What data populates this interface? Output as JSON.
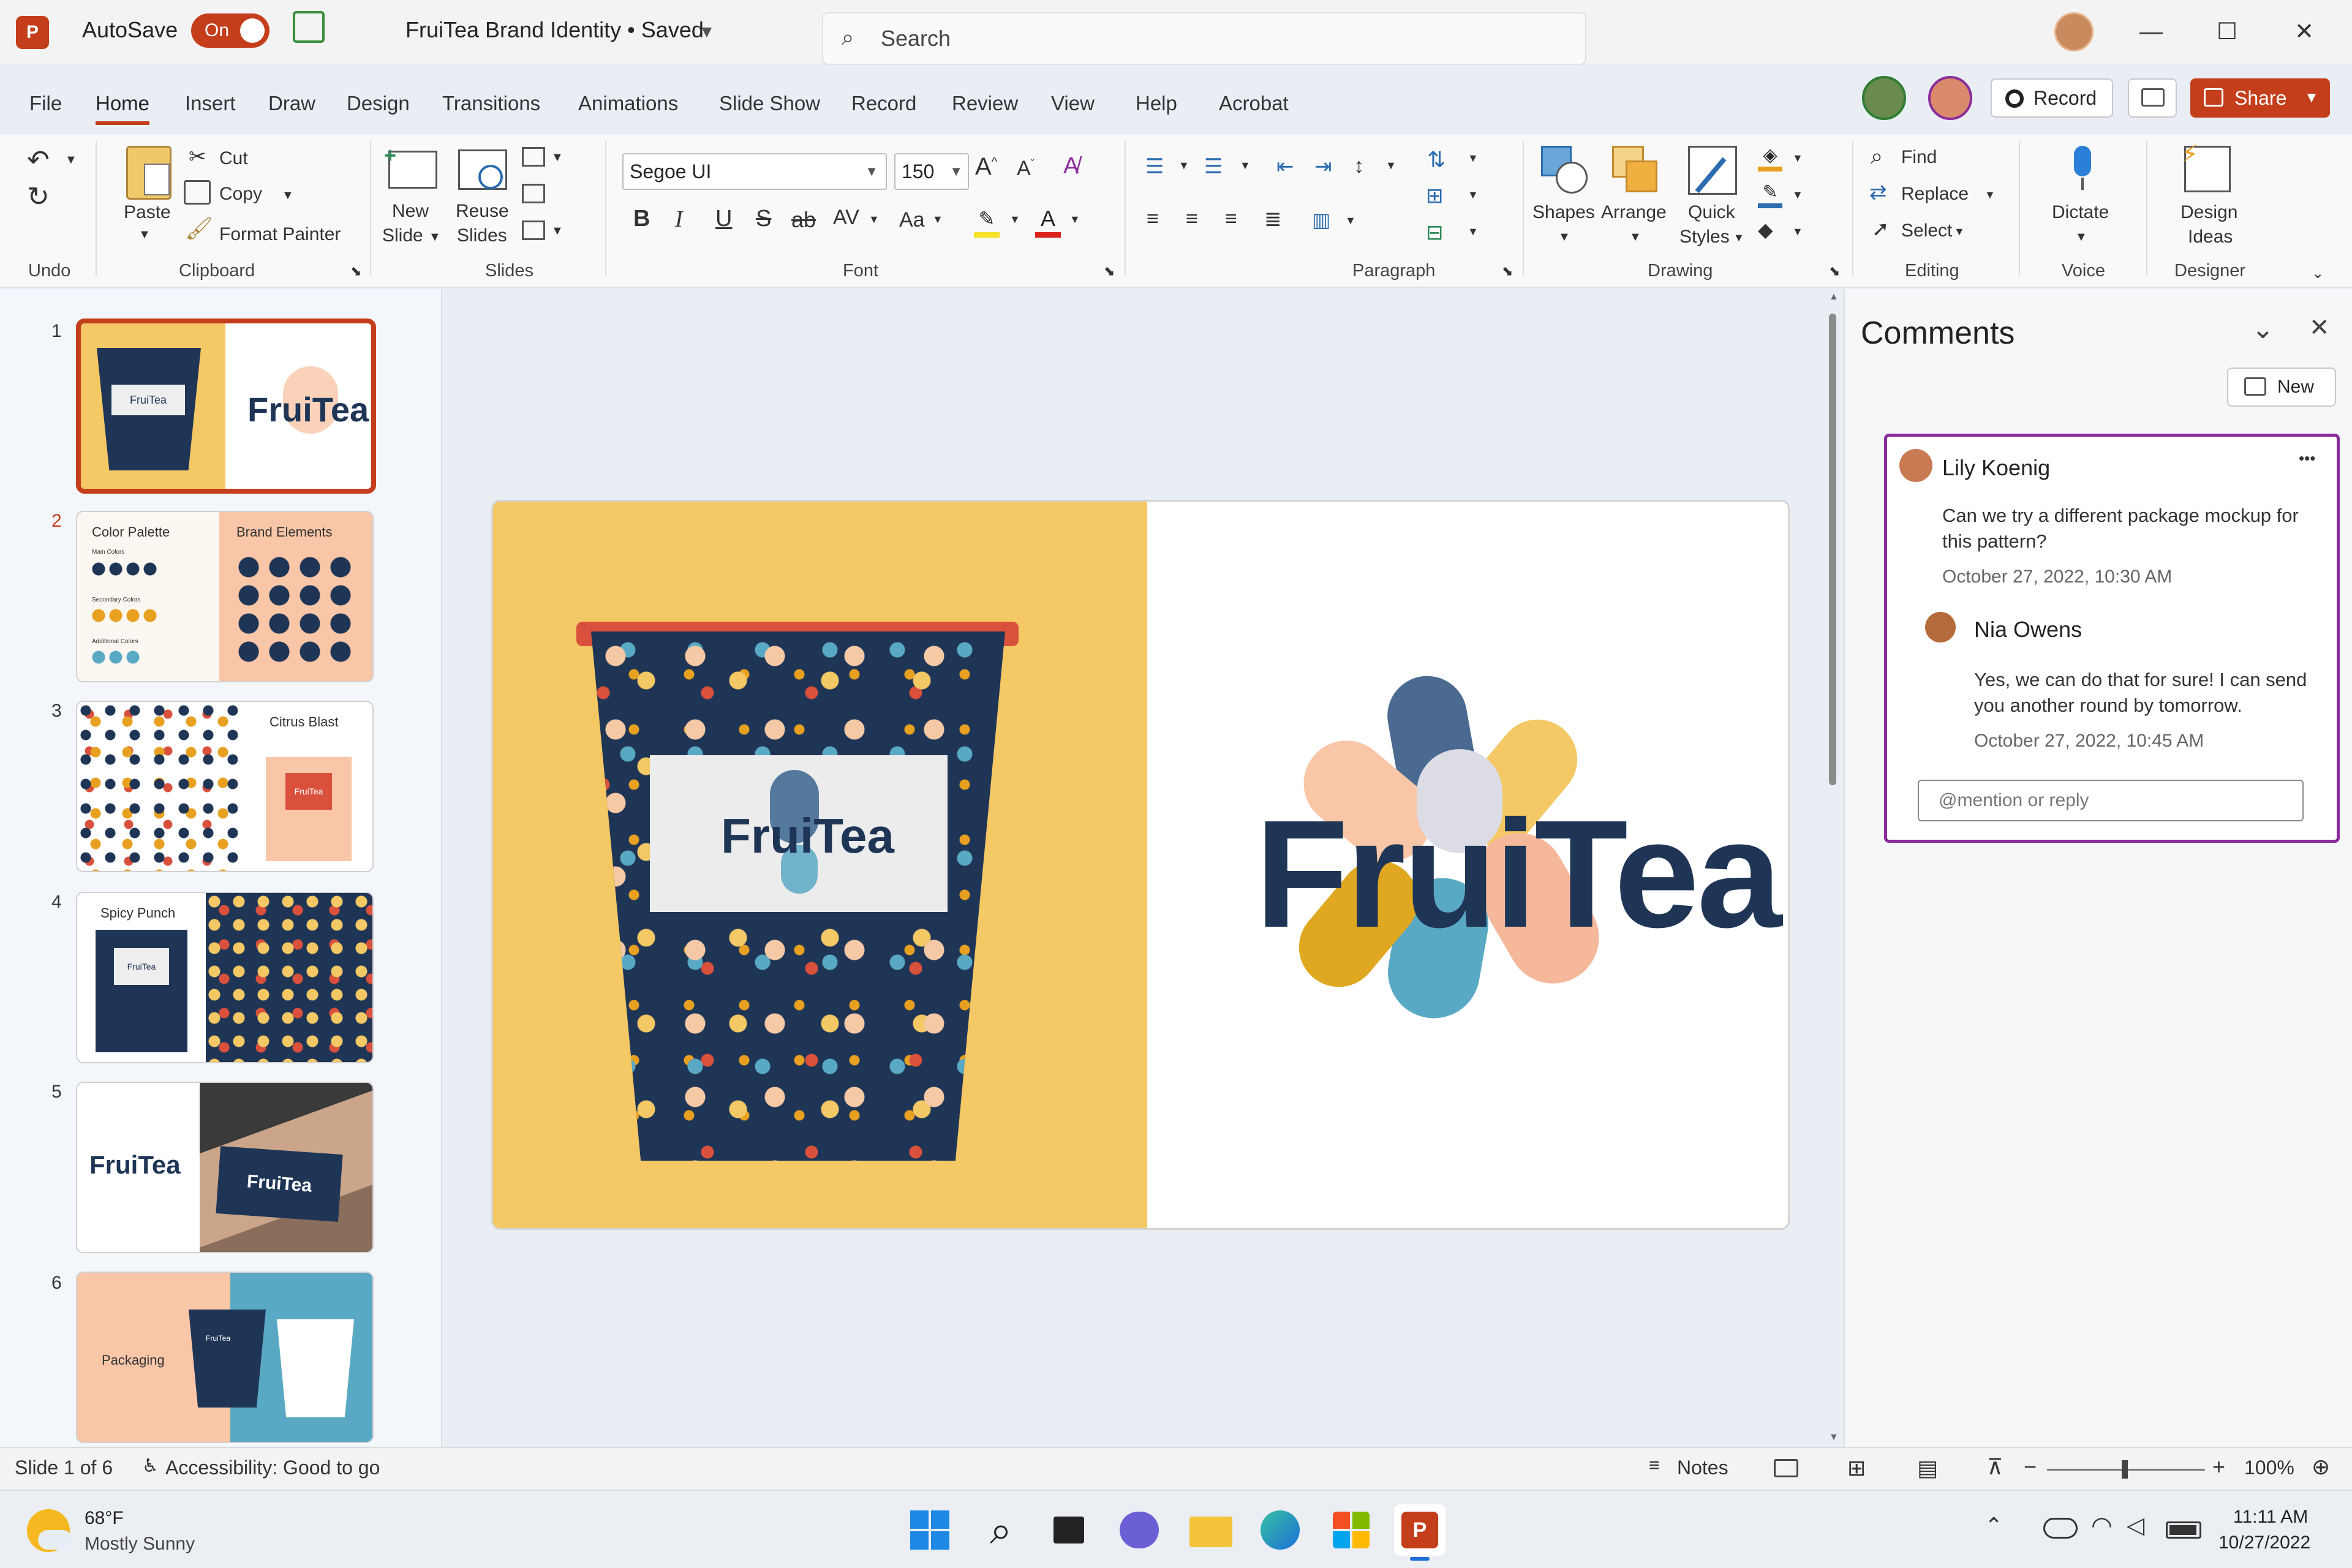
{
  "titlebar": {
    "app_badge": "P",
    "autosave_label": "AutoSave",
    "autosave_state": "On",
    "doc_title": "FruiTea Brand Identity • Saved",
    "search_placeholder": "Search"
  },
  "menu": [
    "File",
    "Home",
    "Insert",
    "Draw",
    "Design",
    "Transitions",
    "Animations",
    "Slide Show",
    "Record",
    "Review",
    "View",
    "Help",
    "Acrobat"
  ],
  "header_buttons": {
    "record": "Record",
    "share": "Share"
  },
  "ribbon": {
    "undo_label": "Undo",
    "clipboard": {
      "paste": "Paste",
      "cut": "Cut",
      "copy": "Copy",
      "format_painter": "Format Painter",
      "label": "Clipboard"
    },
    "slides": {
      "new_slide_1": "New",
      "new_slide_2": "Slide",
      "reuse_1": "Reuse",
      "reuse_2": "Slides",
      "label": "Slides"
    },
    "font": {
      "family": "Segoe UI",
      "size": "150",
      "label": "Font",
      "bold": "B",
      "italic": "I",
      "underline": "U",
      "strike": "S",
      "abc": "ab",
      "spacing": "AV",
      "case": "Aa",
      "grow": "A",
      "shrink": "A"
    },
    "paragraph_label": "Paragraph",
    "drawing": {
      "shapes": "Shapes",
      "arrange": "Arrange",
      "quick_1": "Quick",
      "quick_2": "Styles",
      "label": "Drawing"
    },
    "editing": {
      "find": "Find",
      "replace": "Replace",
      "select": "Select",
      "label": "Editing"
    },
    "voice": {
      "dictate": "Dictate",
      "label": "Voice"
    },
    "designer": {
      "ideas_1": "Design",
      "ideas_2": "Ideas",
      "label": "Designer"
    }
  },
  "thumbnails": [
    {
      "num": "1",
      "logo": "FruiTea"
    },
    {
      "num": "2",
      "left": "Color Palette",
      "right": "Brand Elements",
      "sub1": "Main Colors",
      "sub2": "Secondary Colors",
      "sub3": "Additional Colors"
    },
    {
      "num": "3",
      "title": "Citrus Blast",
      "pack": "FruiTea"
    },
    {
      "num": "4",
      "title": "Spicy Punch",
      "pack": "FruiTea"
    },
    {
      "num": "5",
      "logo": "FruiTea",
      "sign": "FruiTea"
    },
    {
      "num": "6",
      "title": "Packaging",
      "pack": "FruiTea"
    }
  ],
  "slide": {
    "cup_label": "FruiTea",
    "logo": "FruiTea"
  },
  "comments": {
    "title": "Comments",
    "new_button": "New",
    "thread": [
      {
        "author": "Lily Koenig",
        "text": "Can we try a different package mockup for this pattern?",
        "time": "October 27, 2022, 10:30 AM"
      },
      {
        "author": "Nia Owens",
        "text": "Yes, we can do that for sure! I can send you another round by tomorrow.",
        "time": "October 27, 2022, 10:45 AM"
      }
    ],
    "reply_placeholder": "@mention or reply",
    "more": "•••"
  },
  "status": {
    "slide": "Slide 1 of 6",
    "accessibility": "Accessibility: Good to go",
    "notes": "Notes",
    "zoom": "100%",
    "minus": "−",
    "plus": "+"
  },
  "taskbar": {
    "temp": "68°F",
    "weather": "Mostly Sunny",
    "time": "11:11 AM",
    "date": "10/27/2022"
  },
  "colors": {
    "accent": "#c43e1c",
    "comment_border": "#8a2c9c",
    "navy": "#1f3556",
    "yellow": "#f3c865",
    "peach": "#f9c6a8",
    "blue": "#5aa9c4"
  }
}
